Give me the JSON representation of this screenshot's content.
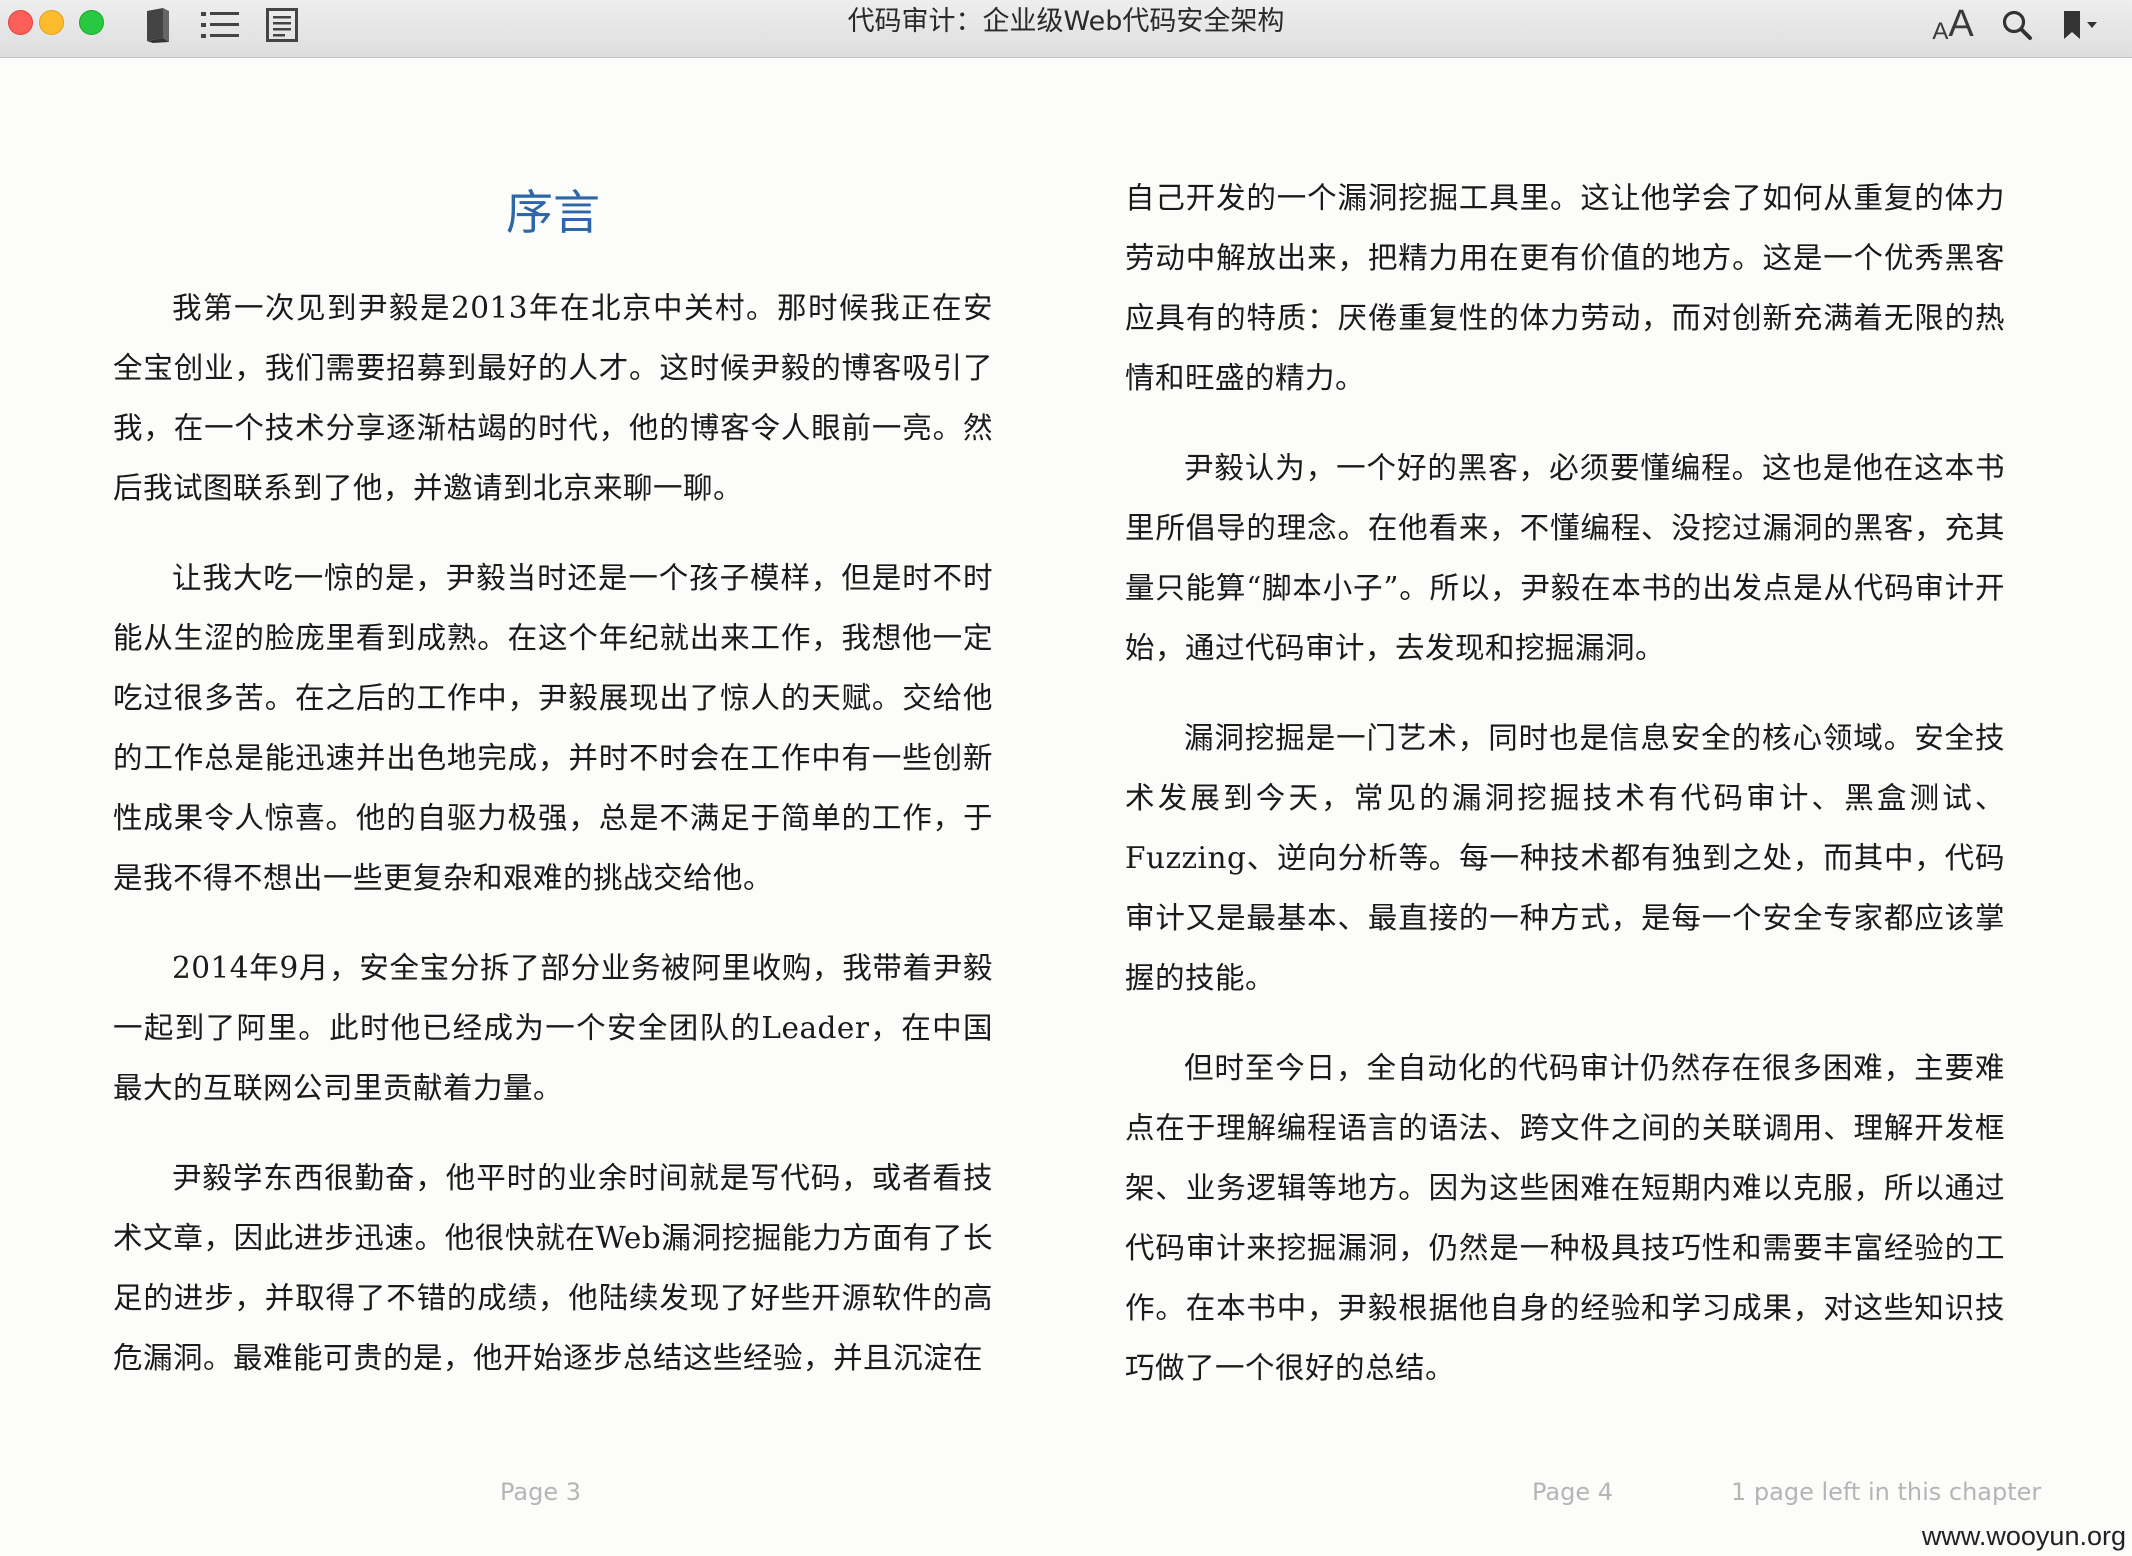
{
  "window": {
    "title": "代码审计：企业级Web代码安全架构"
  },
  "toolbar": {
    "font_size_label_small": "A",
    "font_size_label_large": "A"
  },
  "left_page": {
    "chapter_title": "序言",
    "paragraphs": [
      "我第一次见到尹毅是2013年在北京中关村。那时候我正在安全宝创业，我们需要招募到最好的人才。这时候尹毅的博客吸引了我，在一个技术分享逐渐枯竭的时代，他的博客令人眼前一亮。然后我试图联系到了他，并邀请到北京来聊一聊。",
      "让我大吃一惊的是，尹毅当时还是一个孩子模样，但是时不时能从生涩的脸庞里看到成熟。在这个年纪就出来工作，我想他一定吃过很多苦。在之后的工作中，尹毅展现出了惊人的天赋。交给他的工作总是能迅速并出色地完成，并时不时会在工作中有一些创新性成果令人惊喜。他的自驱力极强，总是不满足于简单的工作，于是我不得不想出一些更复杂和艰难的挑战交给他。",
      "2014年9月，安全宝分拆了部分业务被阿里收购，我带着尹毅一起到了阿里。此时他已经成为一个安全团队的Leader，在中国最大的互联网公司里贡献着力量。",
      "尹毅学东西很勤奋，他平时的业余时间就是写代码，或者看技术文章，因此进步迅速。他很快就在Web漏洞挖掘能力方面有了长足的进步，并取得了不错的成绩，他陆续发现了好些开源软件的高危漏洞。最难能可贵的是，他开始逐步总结这些经验，并且沉淀在"
    ],
    "page_label": "Page 3"
  },
  "right_page": {
    "paragraphs": [
      "自己开发的一个漏洞挖掘工具里。这让他学会了如何从重复的体力劳动中解放出来，把精力用在更有价值的地方。这是一个优秀黑客应具有的特质：厌倦重复性的体力劳动，而对创新充满着无限的热情和旺盛的精力。",
      "尹毅认为，一个好的黑客，必须要懂编程。这也是他在这本书里所倡导的理念。在他看来，不懂编程、没挖过漏洞的黑客，充其量只能算“脚本小子”。所以，尹毅在本书的出发点是从代码审计开始，通过代码审计，去发现和挖掘漏洞。",
      "漏洞挖掘是一门艺术，同时也是信息安全的核心领域。安全技术发展到今天，常见的漏洞挖掘技术有代码审计、黑盒测试、Fuzzing、逆向分析等。每一种技术都有独到之处，而其中，代码审计又是最基本、最直接的一种方式，是每一个安全专家都应该掌握的技能。",
      "但时至今日，全自动化的代码审计仍然存在很多困难，主要难点在于理解编程语言的语法、跨文件之间的关联调用、理解开发框架、业务逻辑等地方。因为这些困难在短期内难以克服，所以通过代码审计来挖掘漏洞，仍然是一种极具技巧性和需要丰富经验的工作。在本书中，尹毅根据他自身的经验和学习成果，对这些知识技巧做了一个很好的总结。"
    ],
    "page_label": "Page 4",
    "remaining_label": "1 page left in this chapter"
  },
  "watermark": "www.wooyun.org",
  "colors": {
    "chapter_title": "#2d67a8",
    "footer_text": "#b5b5b5",
    "traffic_close": "#fc5f57",
    "traffic_minimize": "#fdbc2e",
    "traffic_maximize": "#28c840"
  },
  "icons": [
    "library-icon",
    "toc-icon",
    "notes-icon",
    "font-size-icon",
    "search-icon",
    "bookmark-icon"
  ]
}
